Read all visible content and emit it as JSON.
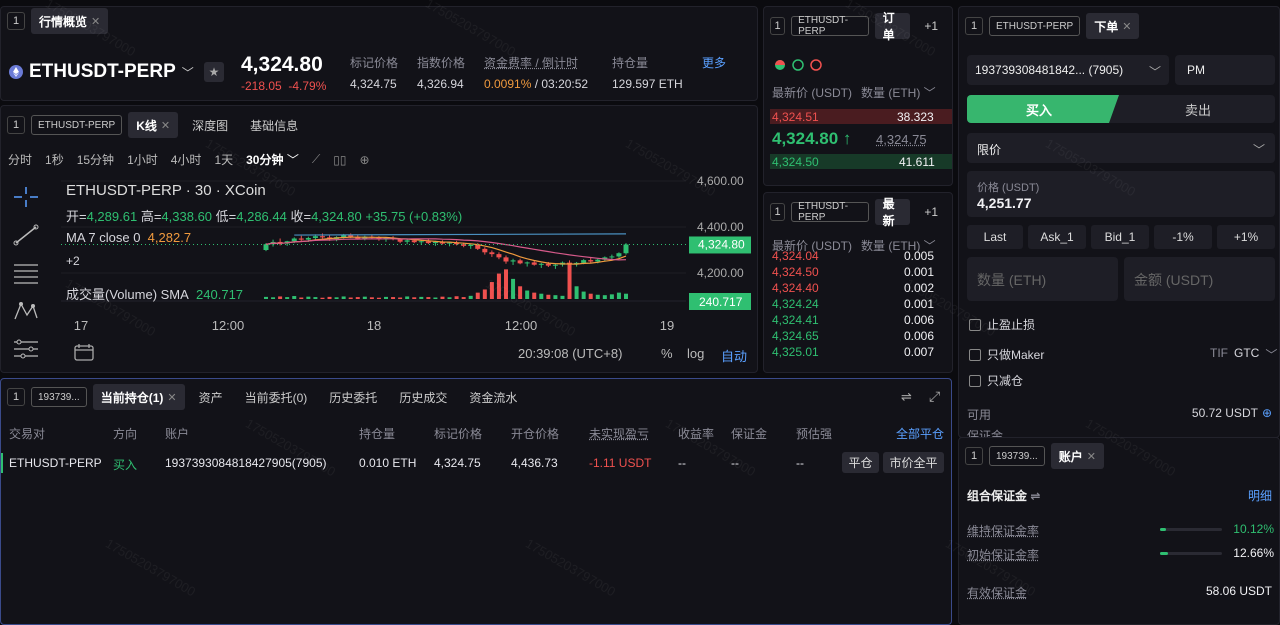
{
  "market": {
    "tab_num": "1",
    "tab_label": "行情概览",
    "symbol": "ETHUSDT-PERP",
    "price": "4,324.80",
    "change": "-218.05",
    "change_pct": "-4.79%",
    "stats": [
      {
        "label": "标记价格",
        "value": "4,324.75"
      },
      {
        "label": "指数价格",
        "value": "4,326.94"
      },
      {
        "label": "资金费率 / 倒计时",
        "value_a": "0.0091%",
        "value_b": "/ 03:20:52"
      },
      {
        "label": "持仓量",
        "value": "129.597 ETH"
      }
    ],
    "more": "更多"
  },
  "chart_panel": {
    "tab_num": "1",
    "tag": "ETHUSDT-PERP",
    "tabs": [
      "K线",
      "深度图",
      "基础信息"
    ],
    "intervals": [
      "分时",
      "1秒",
      "15分钟",
      "1小时",
      "4小时",
      "1天",
      "30分钟"
    ],
    "title": "ETHUSDT-PERP · 30 · XCoin",
    "ohlc": {
      "o_label": "开=",
      "o": "4,289.61",
      "h_label": "高=",
      "h": "4,338.60",
      "l_label": "低=",
      "l": "4,286.44",
      "c_label": "收=",
      "c": "4,324.80",
      "chg": "+35.75 (+0.83%)"
    },
    "ma_label": "MA 7 close 0",
    "ma_value": "4,282.7",
    "plus": "+2",
    "volume_label": "成交量(Volume) SMA",
    "volume_value": "240.717",
    "time_display": "20:39:08 (UTC+8)",
    "footer_pct": "%",
    "footer_log": "log",
    "footer_auto": "自动"
  },
  "chart_data": {
    "type": "candlestick",
    "y_ticks": [
      "4,600.00",
      "4,400.00",
      "4,200.00"
    ],
    "x_ticks": [
      "17",
      "12:00",
      "18",
      "12:00",
      "19"
    ],
    "last_price_label": "4,324.80",
    "volume_label": "240.717",
    "candles": [
      [
        4300,
        4330,
        4295,
        4325
      ],
      [
        4325,
        4345,
        4315,
        4335
      ],
      [
        4335,
        4350,
        4320,
        4328
      ],
      [
        4328,
        4340,
        4318,
        4338
      ],
      [
        4338,
        4355,
        4330,
        4350
      ],
      [
        4350,
        4362,
        4340,
        4345
      ],
      [
        4345,
        4358,
        4335,
        4352
      ],
      [
        4352,
        4368,
        4345,
        4360
      ],
      [
        4360,
        4372,
        4350,
        4355
      ],
      [
        4355,
        4365,
        4340,
        4348
      ],
      [
        4348,
        4360,
        4338,
        4356
      ],
      [
        4356,
        4370,
        4350,
        4364
      ],
      [
        4364,
        4372,
        4352,
        4358
      ],
      [
        4358,
        4366,
        4345,
        4350
      ],
      [
        4350,
        4362,
        4342,
        4358
      ],
      [
        4358,
        4368,
        4348,
        4354
      ],
      [
        4354,
        4360,
        4340,
        4346
      ],
      [
        4346,
        4356,
        4336,
        4352
      ],
      [
        4352,
        4360,
        4342,
        4348
      ],
      [
        4348,
        4352,
        4330,
        4336
      ],
      [
        4336,
        4348,
        4325,
        4342
      ],
      [
        4342,
        4350,
        4330,
        4334
      ],
      [
        4334,
        4342,
        4322,
        4338
      ],
      [
        4338,
        4346,
        4326,
        4330
      ],
      [
        4330,
        4340,
        4318,
        4335
      ],
      [
        4335,
        4342,
        4324,
        4328
      ],
      [
        4328,
        4336,
        4316,
        4332
      ],
      [
        4332,
        4340,
        4320,
        4325
      ],
      [
        4325,
        4332,
        4312,
        4318
      ],
      [
        4318,
        4328,
        4305,
        4322
      ],
      [
        4322,
        4330,
        4300,
        4305
      ],
      [
        4305,
        4312,
        4280,
        4290
      ],
      [
        4290,
        4298,
        4270,
        4282
      ],
      [
        4282,
        4290,
        4260,
        4268
      ],
      [
        4268,
        4276,
        4240,
        4250
      ],
      [
        4250,
        4262,
        4235,
        4255
      ],
      [
        4255,
        4262,
        4238,
        4242
      ],
      [
        4242,
        4250,
        4228,
        4246
      ],
      [
        4246,
        4255,
        4232,
        4236
      ],
      [
        4236,
        4244,
        4222,
        4240
      ],
      [
        4240,
        4248,
        4226,
        4232
      ],
      [
        4232,
        4240,
        4218,
        4236
      ],
      [
        4236,
        4250,
        4228,
        4245
      ],
      [
        4245,
        4255,
        4232,
        4238
      ],
      [
        4238,
        4248,
        4228,
        4244
      ],
      [
        4244,
        4260,
        4238,
        4256
      ],
      [
        4256,
        4266,
        4244,
        4250
      ],
      [
        4250,
        4262,
        4242,
        4258
      ],
      [
        4258,
        4272,
        4250,
        4268
      ],
      [
        4268,
        4280,
        4260,
        4272
      ],
      [
        4272,
        4290,
        4266,
        4286
      ],
      [
        4286,
        4330,
        4280,
        4324
      ]
    ],
    "volumes": [
      10,
      8,
      12,
      9,
      14,
      7,
      11,
      9,
      6,
      10,
      8,
      12,
      7,
      9,
      11,
      8,
      6,
      10,
      9,
      7,
      12,
      8,
      10,
      9,
      7,
      11,
      8,
      13,
      9,
      15,
      30,
      45,
      80,
      120,
      140,
      95,
      60,
      40,
      30,
      25,
      20,
      18,
      15,
      170,
      60,
      35,
      25,
      20,
      18,
      22,
      30,
      25
    ]
  },
  "orderbook1": {
    "tab_num": "1",
    "tag": "ETHUSDT-PERP",
    "tab": "订单",
    "plus": "+1",
    "col_price": "最新价 (USDT)",
    "col_qty": "数量 (ETH)",
    "ask": {
      "price": "4,324.51",
      "qty": "38.323"
    },
    "last": "4,324.80",
    "arrow": "↑",
    "mark": "4,324.75",
    "bid": {
      "price": "4,324.50",
      "qty": "41.611"
    }
  },
  "orderbook2": {
    "tab_num": "1",
    "tag": "ETHUSDT-PERP",
    "tab": "最新",
    "plus": "+1",
    "col_price": "最新价 (USDT)",
    "col_qty": "数量 (ETH)",
    "trades": [
      {
        "price": "4,324.04",
        "qty": "0.005",
        "side": "sell"
      },
      {
        "price": "4,324.50",
        "qty": "0.001",
        "side": "sell"
      },
      {
        "price": "4,324.40",
        "qty": "0.002",
        "side": "sell"
      },
      {
        "price": "4,324.24",
        "qty": "0.001",
        "side": "buy"
      },
      {
        "price": "4,324.41",
        "qty": "0.006",
        "side": "buy"
      },
      {
        "price": "4,324.65",
        "qty": "0.006",
        "side": "buy"
      },
      {
        "price": "4,325.01",
        "qty": "0.007",
        "side": "buy"
      }
    ]
  },
  "order": {
    "tab_num": "1",
    "tag": "ETHUSDT-PERP",
    "tab": "下单",
    "account": "193739308481842... (7905)",
    "pm": "PM",
    "buy": "买入",
    "sell": "卖出",
    "type": "限价",
    "price_label": "价格 (USDT)",
    "price_value": "4,251.77",
    "quick": [
      "Last",
      "Ask_1",
      "Bid_1",
      "-1%",
      "+1%"
    ],
    "qty_placeholder": "数量 (ETH)",
    "amount_placeholder": "金额 (USDT)",
    "tpsl": "止盈止损",
    "maker": "只做Maker",
    "tif_label": "TIF",
    "tif_value": "GTC",
    "reduce": "只减仓",
    "avail_label": "可用",
    "avail_value": "50.72 USDT",
    "margin_cut": "保证金"
  },
  "account": {
    "tab_num": "1",
    "tag": "193739...",
    "tab": "账户",
    "title": "组合保证金",
    "detail": "明细",
    "rows": [
      {
        "label": "维持保证金率",
        "value": "10.12%",
        "ratio": 0.1012,
        "color": "green"
      },
      {
        "label": "初始保证金率",
        "value": "12.66%",
        "ratio": 0.1266,
        "color": "white"
      }
    ],
    "effective_label": "有效保证金",
    "effective_value": "58.06 USDT"
  },
  "positions": {
    "tab_num": "1",
    "tag": "193739...",
    "tabs": [
      "当前持仓(1)",
      "资产",
      "当前委托(0)",
      "历史委托",
      "历史成交",
      "资金流水"
    ],
    "close_all": "全部平仓",
    "headers": [
      "交易对",
      "方向",
      "账户",
      "持仓量",
      "标记价格",
      "开仓价格",
      "未实现盈亏",
      "收益率",
      "保证金",
      "预估强"
    ],
    "row": [
      "ETHUSDT-PERP",
      "买入",
      "1937393084818427905(7905)",
      "0.010 ETH",
      "4,324.75",
      "4,436.73",
      "-1.11 USDT",
      "--",
      "--",
      "--"
    ],
    "btn_close": "平仓",
    "btn_market_close": "市价全平"
  },
  "watermark": "17505203797000"
}
